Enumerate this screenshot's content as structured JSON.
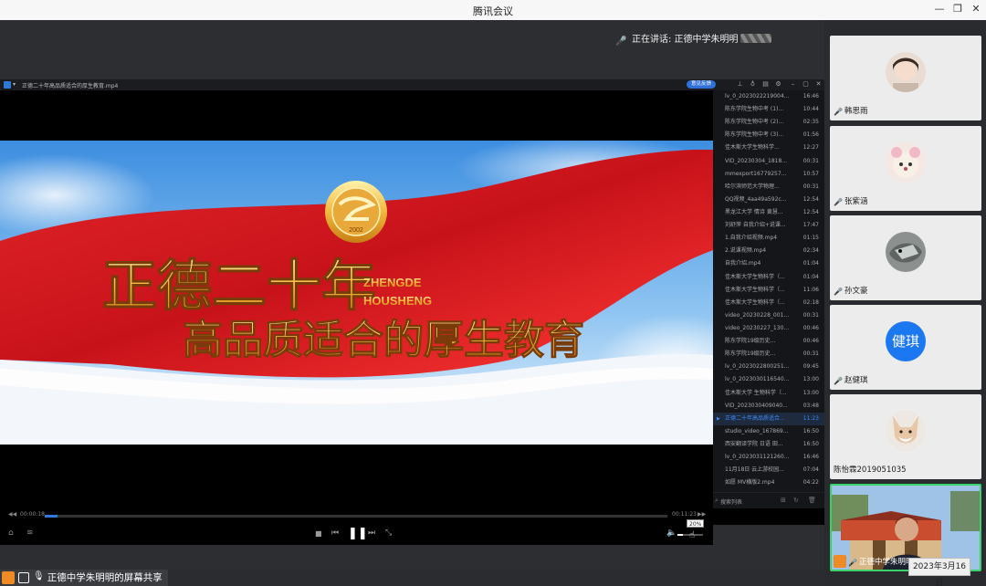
{
  "window": {
    "title": "腾讯会议"
  },
  "speaker": {
    "prefix": "正在讲话: 正德中学朱明明"
  },
  "player": {
    "file_name": "正德二十年高品质适合的厚生教育.mp4",
    "feedback_label": "意见反馈",
    "video": {
      "title_line1": "正德二十年",
      "title_line2": "高品质适合的厚生教育",
      "brand_line1": "ZHENGDE",
      "brand_line2": "HOUSHENG",
      "emblem_year": "2002"
    },
    "elapsed": "00:00:18",
    "total": "00:11:23",
    "progress": 0.02,
    "volume_label": "20%",
    "volume": 0.2
  },
  "playlist": {
    "active_index": 25,
    "search_label": "搜索列表",
    "items": [
      {
        "name": "lv_0_2023022219004...",
        "dur": "16:46"
      },
      {
        "name": "陈东学院生物中考 (1)...",
        "dur": "10:44"
      },
      {
        "name": "陈东学院生物中考 (2)...",
        "dur": "02:35"
      },
      {
        "name": "陈东学院生物中考 (3)...",
        "dur": "01:56"
      },
      {
        "name": "佳木斯大学生物科学...",
        "dur": "12:27"
      },
      {
        "name": "VID_20230304_1818...",
        "dur": "00:31"
      },
      {
        "name": "mmexport16779257...",
        "dur": "10:57"
      },
      {
        "name": "哈尔滨师范大学物理...",
        "dur": "00:31"
      },
      {
        "name": "QQ视频_4aa49a592c...",
        "dur": "12:54"
      },
      {
        "name": "黑龙江大学 情诗 黄慧...",
        "dur": "12:54"
      },
      {
        "name": "刘舒萍 自我介绍+说课...",
        "dur": "17:47"
      },
      {
        "name": "1.自我介绍视频.mp4",
        "dur": "01:15"
      },
      {
        "name": "2.说课视频.mp4",
        "dur": "02:34"
      },
      {
        "name": "自我介绍.mp4",
        "dur": "01:04"
      },
      {
        "name": "佳木斯大学生物科学（...",
        "dur": "01:04"
      },
      {
        "name": "佳木斯大学生物科学（...",
        "dur": "11:06"
      },
      {
        "name": "佳木斯大学生物科学（...",
        "dur": "02:18"
      },
      {
        "name": "video_20230228_001...",
        "dur": "00:31"
      },
      {
        "name": "video_20230227_130...",
        "dur": "00:46"
      },
      {
        "name": "陈东学院19级历史...",
        "dur": "00:46"
      },
      {
        "name": "陈东学院19级历史...",
        "dur": "00:31"
      },
      {
        "name": "lv_0_2023022800251...",
        "dur": "09:45"
      },
      {
        "name": "lv_0_2023030116540...",
        "dur": "13:00"
      },
      {
        "name": "佳木斯大学 生物科学（...",
        "dur": "13:00"
      },
      {
        "name": "VID_2023030409040...",
        "dur": "03:48"
      },
      {
        "name": "正德二十年高品质适合...",
        "dur": "11:23"
      },
      {
        "name": "studio_video_167869...",
        "dur": "16:50"
      },
      {
        "name": "西安翻译学院 日语 田...",
        "dur": "16:50"
      },
      {
        "name": "lv_0_2023031121260...",
        "dur": "16:46"
      },
      {
        "name": "11月18日 云上游校园...",
        "dur": "07:04"
      },
      {
        "name": "如愿 MV横版2.mp4",
        "dur": "04:22"
      }
    ]
  },
  "participants": [
    {
      "name": "韩思雨",
      "initial": ""
    },
    {
      "name": "张紫涵",
      "initial": ""
    },
    {
      "name": "孙文豪",
      "initial": ""
    },
    {
      "name": "赵健琪",
      "initial": "健琪"
    },
    {
      "name": "陈怡霖2019051035",
      "initial": ""
    },
    {
      "name": "正德中学朱明明",
      "initial": ""
    }
  ],
  "share_bar": {
    "label": "正德中学朱明明的屏幕共享"
  },
  "date_badge": "2023年3月16日",
  "colors": {
    "accent": "#2f6fd8",
    "active_border": "#3cd16a",
    "avatar_blue": "#1b78f0"
  }
}
